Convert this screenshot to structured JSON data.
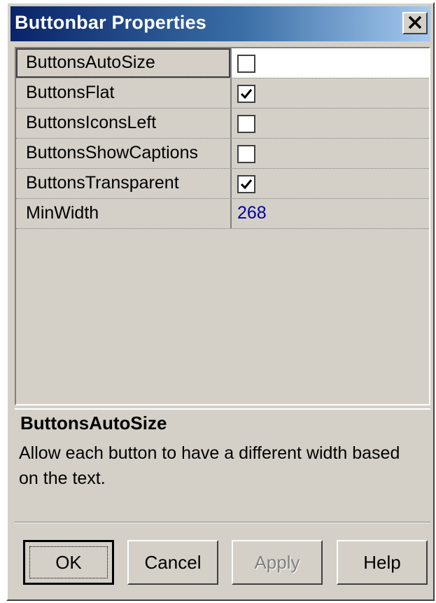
{
  "window": {
    "title": "Buttonbar Properties",
    "close_label": "✕"
  },
  "properties": [
    {
      "name": "ButtonsAutoSize",
      "type": "checkbox",
      "checked": false,
      "selected": true
    },
    {
      "name": "ButtonsFlat",
      "type": "checkbox",
      "checked": true
    },
    {
      "name": "ButtonsIconsLeft",
      "type": "checkbox",
      "checked": false
    },
    {
      "name": "ButtonsShowCaptions",
      "type": "checkbox",
      "checked": false
    },
    {
      "name": "ButtonsTransparent",
      "type": "checkbox",
      "checked": true
    },
    {
      "name": "MinWidth",
      "type": "text",
      "value": "268"
    }
  ],
  "description": {
    "title": "ButtonsAutoSize",
    "text": "Allow each button to have a different width based on the text."
  },
  "buttons": {
    "ok": "OK",
    "cancel": "Cancel",
    "apply": "Apply",
    "help": "Help"
  },
  "colors": {
    "title_gradient_start": "#0a246a",
    "title_gradient_end": "#a6caf0",
    "face": "#d4d0c8",
    "value_text": "#0000a0"
  }
}
